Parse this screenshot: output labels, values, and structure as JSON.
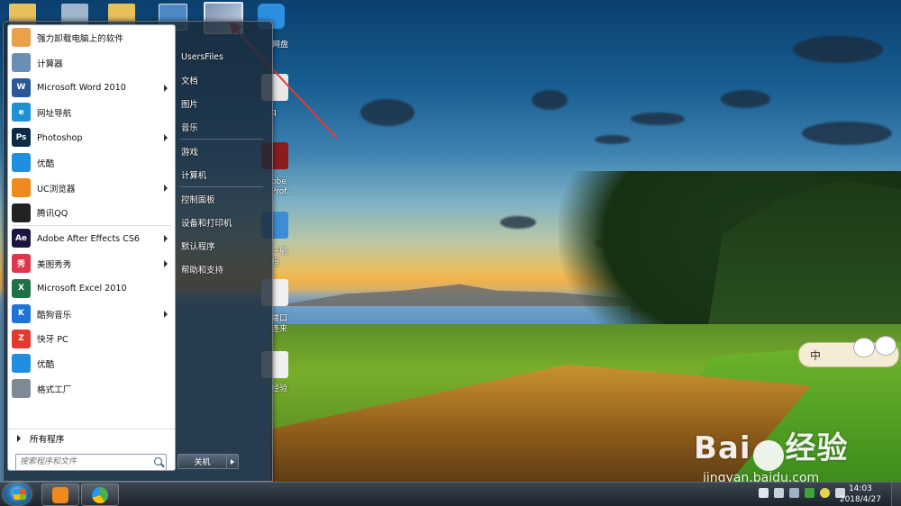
{
  "desktop": {
    "top_icon_label": "网盘",
    "side_labels": [
      "q",
      "obe",
      "Prof...",
      "一刷",
      "程",
      "端口",
      "连来",
      "经验"
    ]
  },
  "start_menu": {
    "programs": [
      {
        "label": "强力卸载电脑上的软件",
        "icon": "uninstaller-icon",
        "color": "#e9a24a",
        "glyph": "",
        "submenu": false
      },
      {
        "label": "计算器",
        "icon": "calculator-icon",
        "color": "#6a8fb5",
        "glyph": "",
        "submenu": false
      },
      {
        "label": "Microsoft Word 2010",
        "icon": "word-icon",
        "color": "#2b5797",
        "glyph": "W",
        "submenu": true
      },
      {
        "label": "网址导航",
        "icon": "ie-icon",
        "color": "#1e90d8",
        "glyph": "e",
        "submenu": false
      },
      {
        "label": "Photoshop",
        "icon": "photoshop-icon",
        "color": "#0a2a45",
        "glyph": "Ps",
        "submenu": true
      },
      {
        "label": "优酷",
        "icon": "youku-icon",
        "color": "#1f8de0",
        "glyph": "",
        "submenu": false
      },
      {
        "label": "UC浏览器",
        "icon": "uc-browser-icon",
        "color": "#f08a1c",
        "glyph": "",
        "submenu": true
      },
      {
        "label": "腾讯QQ",
        "icon": "qq-icon",
        "color": "#222222",
        "glyph": "",
        "submenu": false
      },
      {
        "label": "Adobe After Effects CS6",
        "icon": "after-effects-icon",
        "color": "#1a1640",
        "glyph": "Ae",
        "submenu": true
      },
      {
        "label": "美图秀秀",
        "icon": "meitu-icon",
        "color": "#e0354b",
        "glyph": "秀",
        "submenu": true
      },
      {
        "label": "Microsoft Excel 2010",
        "icon": "excel-icon",
        "color": "#1e7145",
        "glyph": "X",
        "submenu": false
      },
      {
        "label": "酷狗音乐",
        "icon": "kugou-icon",
        "color": "#1e73d6",
        "glyph": "K",
        "submenu": true
      },
      {
        "label": "快牙 PC",
        "icon": "kuaiya-icon",
        "color": "#e23a2e",
        "glyph": "Z",
        "submenu": false
      },
      {
        "label": "优酷",
        "icon": "youku-icon",
        "color": "#1f8de0",
        "glyph": "",
        "submenu": false
      },
      {
        "label": "格式工厂",
        "icon": "format-factory-icon",
        "color": "#7d8a96",
        "glyph": "",
        "submenu": false
      }
    ],
    "all_programs": "所有程序",
    "search_placeholder": "搜索程序和文件",
    "right_items": [
      {
        "label": "UsersFiles",
        "name": "right-item-usersfiles"
      },
      {
        "label": "文档",
        "name": "right-item-documents"
      },
      {
        "label": "图片",
        "name": "right-item-pictures"
      },
      {
        "label": "音乐",
        "name": "right-item-music"
      },
      {
        "label": "游戏",
        "name": "right-item-games"
      },
      {
        "label": "计算机",
        "name": "right-item-computer"
      },
      {
        "label": "控制面板",
        "name": "right-item-control-panel"
      },
      {
        "label": "设备和打印机",
        "name": "right-item-devices-printers"
      },
      {
        "label": "默认程序",
        "name": "right-item-default-programs"
      },
      {
        "label": "帮助和支持",
        "name": "right-item-help-support"
      }
    ],
    "shutdown_label": "关机"
  },
  "taskbar": {
    "time": "14:03",
    "date": "2018/4/27"
  },
  "ime": {
    "label": "中"
  },
  "watermark": {
    "brand": "Bai",
    "brand2": "经验",
    "url": "jingyan.baidu.com"
  },
  "colors": {
    "accent_arrow": "#e53a35"
  }
}
